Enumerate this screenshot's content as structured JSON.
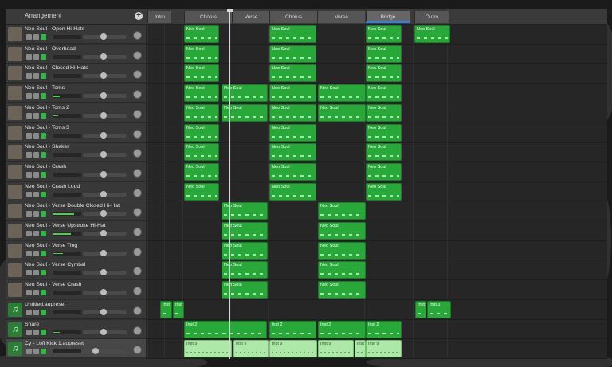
{
  "header": {
    "title": "Arrangement",
    "add_icon": "plus-icon"
  },
  "sections": [
    "Intro",
    "Chorus",
    "Verse",
    "Chorus",
    "Verse",
    "Bridge",
    "Outro"
  ],
  "selected_section": "Bridge",
  "tracks": [
    {
      "name": "Neo Soul - Open Hi-Hats",
      "kind": "drummer"
    },
    {
      "name": "Neo Soul - Overhead",
      "kind": "drummer"
    },
    {
      "name": "Neo Soul - Closed Hi-Hats",
      "kind": "drummer"
    },
    {
      "name": "Neo Soul - Toms",
      "kind": "drummer"
    },
    {
      "name": "Neo Soul - Toms 2",
      "kind": "drummer"
    },
    {
      "name": "Neo Soul - Toms 3",
      "kind": "drummer"
    },
    {
      "name": "Neo Soul - Shaker",
      "kind": "drummer"
    },
    {
      "name": "Neo Soul - Crash",
      "kind": "drummer"
    },
    {
      "name": "Neo Soul - Crash Loud",
      "kind": "drummer"
    },
    {
      "name": "Neo Soul - Verse Double Closed Hi-Hat",
      "kind": "drummer"
    },
    {
      "name": "Neo Soul - Verse Upstroke Hi-Hat",
      "kind": "drummer"
    },
    {
      "name": "Neo Soul - Verse Ting",
      "kind": "drummer"
    },
    {
      "name": "Neo Soul - Verse Cymbal",
      "kind": "drummer"
    },
    {
      "name": "Neo Soul - Verse Crash",
      "kind": "drummer"
    },
    {
      "name": "Untitled.aupreset",
      "kind": "instrument"
    },
    {
      "name": "Snare",
      "kind": "instrument"
    },
    {
      "name": "Cy - Lofi Kick 1.aupreset",
      "kind": "instrument",
      "selected": true
    }
  ],
  "region_labels": {
    "drummer": "Neo Soul",
    "inst1": "Inst",
    "inst2": "Inst 2",
    "inst3": "Inst 3",
    "inst9": "Inst 9"
  },
  "track_icons": {
    "mute": "mute-icon",
    "solo": "headphones-icon",
    "lock": "lock-icon",
    "note": "music-note-icon"
  },
  "colors": {
    "region": "#29a83a",
    "region_selected": "#aee8a8",
    "section_selected": "#3b7fd1"
  }
}
